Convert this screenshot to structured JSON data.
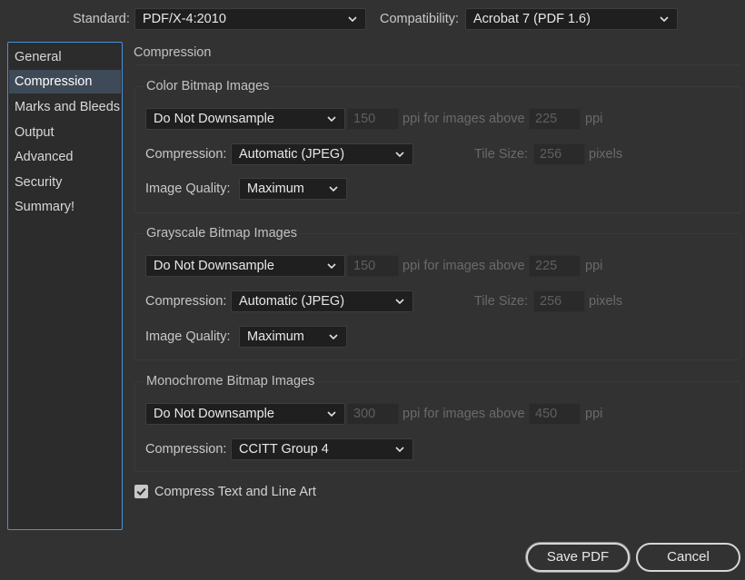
{
  "header": {
    "standard_label": "Standard:",
    "standard_value": "PDF/X-4:2010",
    "compatibility_label": "Compatibility:",
    "compatibility_value": "Acrobat 7 (PDF 1.6)"
  },
  "sidebar": {
    "items": [
      {
        "label": "General"
      },
      {
        "label": "Compression"
      },
      {
        "label": "Marks and Bleeds"
      },
      {
        "label": "Output"
      },
      {
        "label": "Advanced"
      },
      {
        "label": "Security"
      },
      {
        "label": "Summary!"
      }
    ],
    "active_index": 1
  },
  "main": {
    "title": "Compression",
    "color": {
      "title": "Color Bitmap Images",
      "downsample": "Do Not Downsample",
      "ppi": "150",
      "above_label": "ppi for images above",
      "above_value": "225",
      "ppi_unit": "ppi",
      "compression_label": "Compression:",
      "compression_value": "Automatic (JPEG)",
      "tile_label": "Tile Size:",
      "tile_value": "256",
      "tile_unit": "pixels",
      "quality_label": "Image Quality:",
      "quality_value": "Maximum"
    },
    "grayscale": {
      "title": "Grayscale Bitmap Images",
      "downsample": "Do Not Downsample",
      "ppi": "150",
      "above_label": "ppi for images above",
      "above_value": "225",
      "ppi_unit": "ppi",
      "compression_label": "Compression:",
      "compression_value": "Automatic (JPEG)",
      "tile_label": "Tile Size:",
      "tile_value": "256",
      "tile_unit": "pixels",
      "quality_label": "Image Quality:",
      "quality_value": "Maximum"
    },
    "monochrome": {
      "title": "Monochrome Bitmap Images",
      "downsample": "Do Not Downsample",
      "ppi": "300",
      "above_label": "ppi for images above",
      "above_value": "450",
      "ppi_unit": "ppi",
      "compression_label": "Compression:",
      "compression_value": "CCITT Group 4"
    },
    "compress_text_label": "Compress Text and Line Art",
    "compress_text_checked": true
  },
  "footer": {
    "save_label": "Save PDF",
    "cancel_label": "Cancel"
  },
  "colors": {
    "background": "#323232",
    "field": "#1f1f1f",
    "focus_border": "#4a8fd8",
    "selected_row": "#3e4a57"
  }
}
